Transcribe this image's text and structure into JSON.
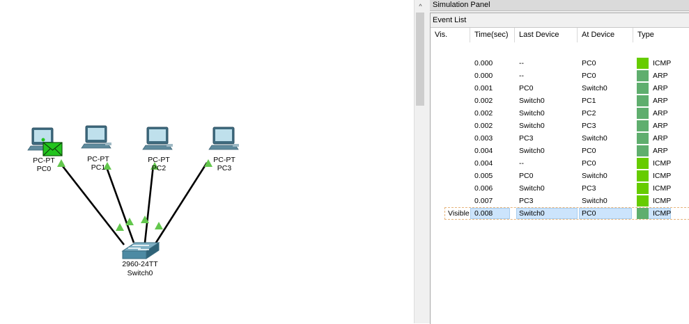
{
  "panel": {
    "title": "Simulation Panel",
    "event_list_title": "Event List",
    "columns": [
      "Vis.",
      "Time(sec)",
      "Last Device",
      "At Device",
      "Type"
    ],
    "rows": [
      {
        "vis": "",
        "time": "0.000",
        "last": "--",
        "at": "PC0",
        "type": "ICMP",
        "color": "#66cc00"
      },
      {
        "vis": "",
        "time": "0.000",
        "last": "--",
        "at": "PC0",
        "type": "ARP",
        "color": "#5fae6e"
      },
      {
        "vis": "",
        "time": "0.001",
        "last": "PC0",
        "at": "Switch0",
        "type": "ARP",
        "color": "#5fae6e"
      },
      {
        "vis": "",
        "time": "0.002",
        "last": "Switch0",
        "at": "PC1",
        "type": "ARP",
        "color": "#5fae6e"
      },
      {
        "vis": "",
        "time": "0.002",
        "last": "Switch0",
        "at": "PC2",
        "type": "ARP",
        "color": "#5fae6e"
      },
      {
        "vis": "",
        "time": "0.002",
        "last": "Switch0",
        "at": "PC3",
        "type": "ARP",
        "color": "#5fae6e"
      },
      {
        "vis": "",
        "time": "0.003",
        "last": "PC3",
        "at": "Switch0",
        "type": "ARP",
        "color": "#5fae6e"
      },
      {
        "vis": "",
        "time": "0.004",
        "last": "Switch0",
        "at": "PC0",
        "type": "ARP",
        "color": "#5fae6e"
      },
      {
        "vis": "",
        "time": "0.004",
        "last": "--",
        "at": "PC0",
        "type": "ICMP",
        "color": "#66cc00"
      },
      {
        "vis": "",
        "time": "0.005",
        "last": "PC0",
        "at": "Switch0",
        "type": "ICMP",
        "color": "#66cc00"
      },
      {
        "vis": "",
        "time": "0.006",
        "last": "Switch0",
        "at": "PC3",
        "type": "ICMP",
        "color": "#66cc00"
      },
      {
        "vis": "",
        "time": "0.007",
        "last": "PC3",
        "at": "Switch0",
        "type": "ICMP",
        "color": "#66cc00"
      },
      {
        "vis": "Visible",
        "time": "0.008",
        "last": "Switch0",
        "at": "PC0",
        "type": "ICMP",
        "color": "#5fae6e",
        "selected": true
      }
    ]
  },
  "topology": {
    "devices": [
      {
        "type_label": "PC-PT",
        "name": "PC0",
        "icon": "pc-icon"
      },
      {
        "type_label": "PC-PT",
        "name": "PC1",
        "icon": "pc-icon"
      },
      {
        "type_label": "PC-PT",
        "name": "PC2",
        "icon": "pc-icon"
      },
      {
        "type_label": "PC-PT",
        "name": "PC3",
        "icon": "pc-icon"
      }
    ],
    "switch": {
      "type_label": "2960-24TT",
      "name": "Switch0",
      "icon": "switch-icon"
    },
    "pdu_icon": "envelope-icon",
    "link_state_color": "#63c74d"
  },
  "scrollbar": {
    "up_arrow": "^"
  },
  "colors": {
    "icmp": "#66cc00",
    "arp": "#5fae6e",
    "selection": "#cce4fc"
  }
}
